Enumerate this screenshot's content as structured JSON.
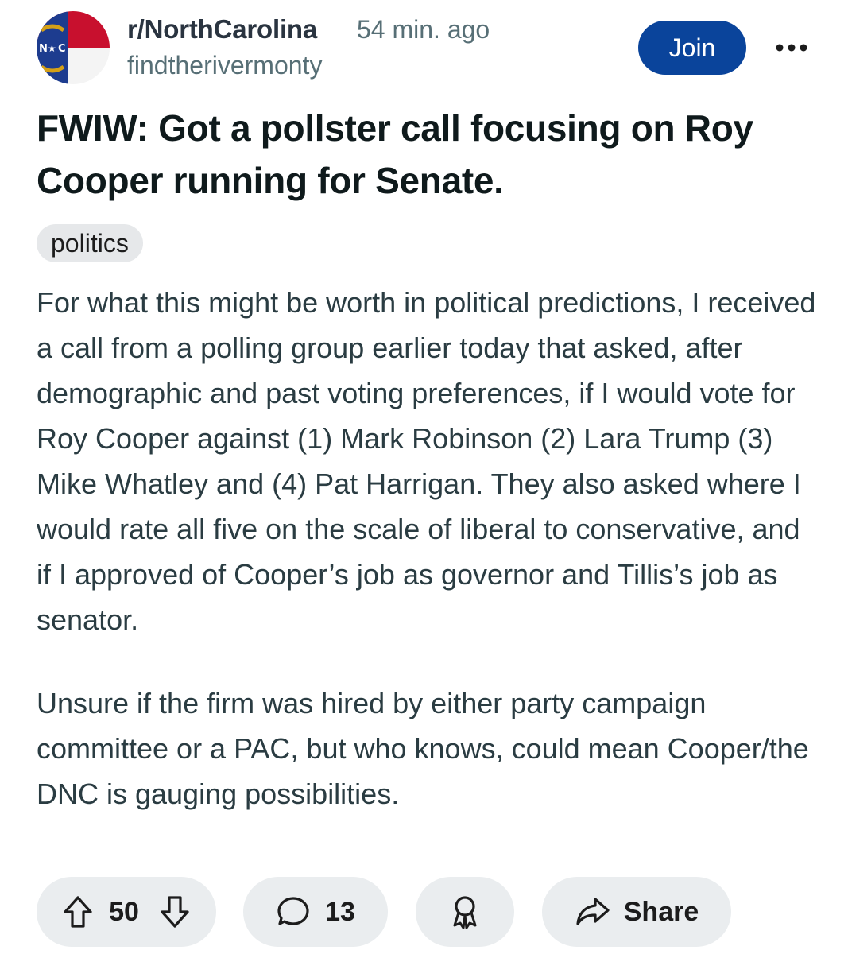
{
  "post": {
    "subreddit": "r/NorthCarolina",
    "age": "54 min. ago",
    "author": "findtherivermonty",
    "join_label": "Join",
    "title": "FWIW: Got a pollster call focusing on Roy Cooper running for Senate.",
    "flair": "politics",
    "body": [
      "For what this might be worth in political predictions, I received a call from a polling group earlier today that asked, after demographic and past voting preferences, if I would vote for Roy Cooper against (1) Mark Robinson (2) Lara Trump (3) Mike Whatley and (4) Pat Harrigan. They also asked where I would rate all five on the scale of liberal to conservative, and if I approved of Cooper’s job as governor and Tillis’s job as senator.",
      "Unsure if the firm was hired by either party campaign committee or a PAC, but who knows, could mean Cooper/the DNC is gauging possibilities."
    ]
  },
  "avatar": {
    "text": "N★C",
    "colors": {
      "blue": "#1d3c8f",
      "red": "#c8102e",
      "white": "#ffffff",
      "gold": "#d4a017"
    }
  },
  "actions": {
    "vote_count": "50",
    "comment_count": "13",
    "share_label": "Share"
  },
  "colors": {
    "join_bg": "#0a449b",
    "meta_text": "#576f76",
    "pill_bg": "#eaedef"
  },
  "icons": [
    "upvote-icon",
    "downvote-icon",
    "comment-icon",
    "award-icon",
    "share-icon",
    "more-icon"
  ]
}
